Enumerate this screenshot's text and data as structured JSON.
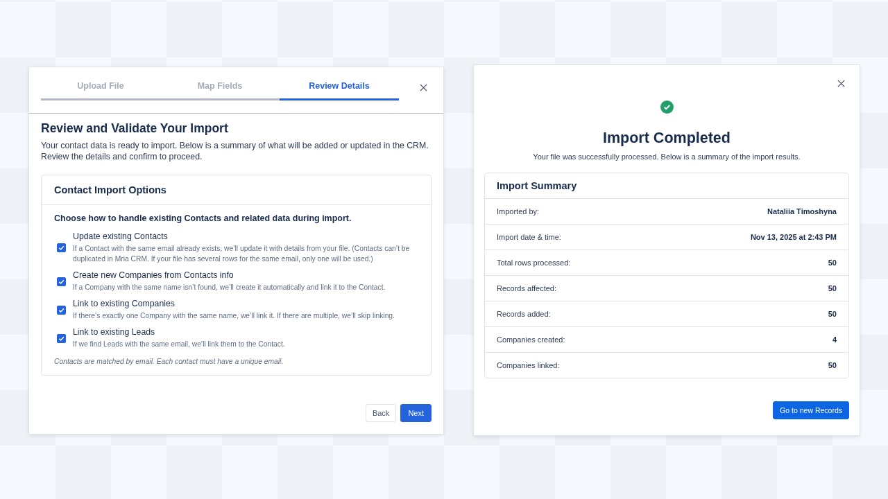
{
  "import_wizard": {
    "steps": [
      {
        "label": "Upload File",
        "selected": false
      },
      {
        "label": "Map Fields",
        "selected": false
      },
      {
        "label": "Review Details",
        "selected": true
      }
    ],
    "title": "Review and Validate Your Import",
    "description": "Your contact data is ready to import. Below is a summary of what will be added or updated in the CRM. Review the details and confirm to proceed.",
    "options_card": {
      "title": "Contact Import Options",
      "prompt": "Choose how to handle existing Contacts and related data during import.",
      "options": [
        {
          "label": "Update existing Contacts",
          "hint": "If a Contact with the same email already exists, we’ll update it with details from your file. (Contacts can’t be duplicated in Mria CRM. If your file has several rows for the same email, only one will be used.)",
          "checked": true
        },
        {
          "label": "Create new Companies from Contacts info",
          "hint": "If a Company with the same name isn’t found, we’ll create it automatically and link it to the Contact.",
          "checked": true
        },
        {
          "label": "Link to existing Companies",
          "hint": "If there’s exactly one Company with the same name, we’ll link it. If there are multiple, we’ll skip linking.",
          "checked": true
        },
        {
          "label": "Link to existing Leads",
          "hint": "If we find Leads with the same email, we’ll link them to the Contact.",
          "checked": true
        }
      ],
      "footnote": "Contacts are matched by email. Each contact must have a unique email."
    },
    "buttons": [
      "Back",
      "Next"
    ]
  },
  "import_result": {
    "title": "Import Completed",
    "subtitle": "Your file was successfully processed. Below is a summary of the import results.",
    "summary": {
      "title": "Import Summary",
      "rows": [
        {
          "label": "Imported by:",
          "value": "Nataliia Timoshyna"
        },
        {
          "label": "Import date & time:",
          "value": "Nov 13, 2025 at 2:43 PM"
        },
        {
          "label": "Total rows processed:",
          "value": "50"
        },
        {
          "label": "Records affected:",
          "value": "50"
        },
        {
          "label": "Records added:",
          "value": "50"
        },
        {
          "label": "Companies created:",
          "value": "4"
        },
        {
          "label": "Companies linked:",
          "value": "50"
        }
      ]
    },
    "button": "Go to new Records"
  }
}
